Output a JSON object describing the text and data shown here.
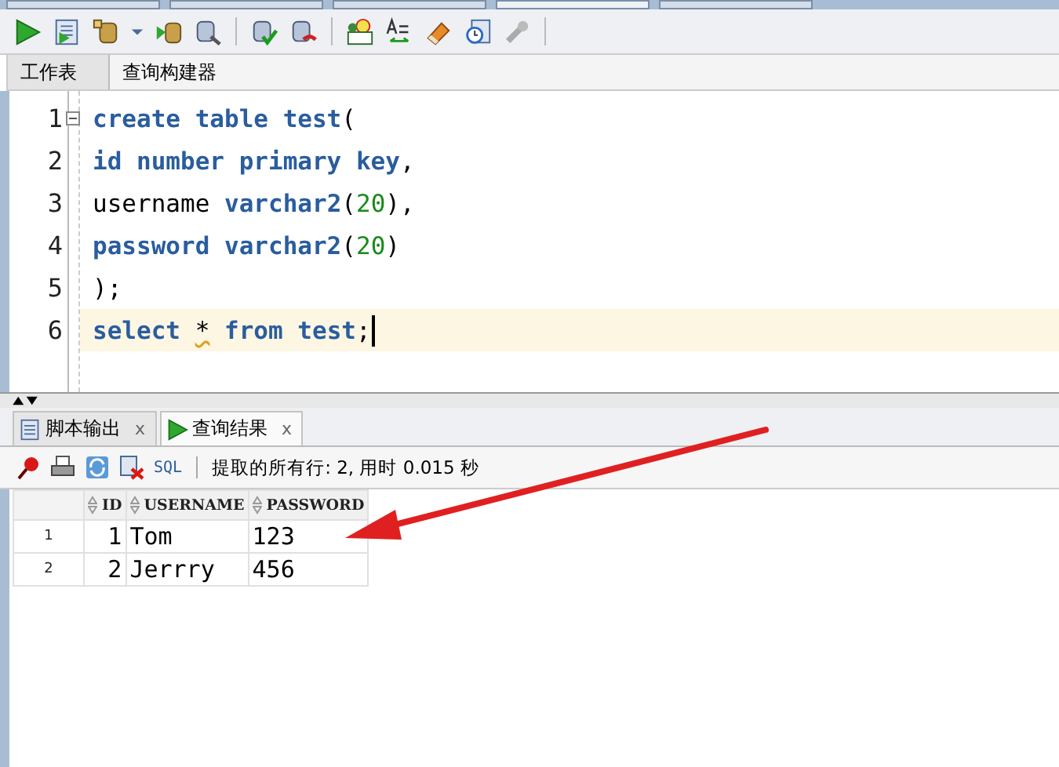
{
  "document_tabs": [
    {
      "selected": false
    },
    {
      "selected": false
    },
    {
      "selected": false
    },
    {
      "selected": true
    },
    {
      "selected": false
    }
  ],
  "editor_tabs": [
    {
      "label": "工作表",
      "selected": true
    },
    {
      "label": "查询构建器",
      "selected": false
    }
  ],
  "editor": {
    "lines": [
      {
        "number": "1",
        "fold": true,
        "current": false,
        "tokens": [
          {
            "kind": "keyword",
            "text": "create table test"
          },
          {
            "kind": "punct",
            "text": "("
          }
        ]
      },
      {
        "number": "2",
        "fold": false,
        "current": false,
        "tokens": [
          {
            "kind": "keyword",
            "text": "id number primary key"
          },
          {
            "kind": "punct",
            "text": ","
          }
        ]
      },
      {
        "number": "3",
        "fold": false,
        "current": false,
        "tokens": [
          {
            "kind": "plain",
            "text": "username "
          },
          {
            "kind": "keyword",
            "text": "varchar2"
          },
          {
            "kind": "punct",
            "text": "("
          },
          {
            "kind": "number",
            "text": "20"
          },
          {
            "kind": "punct",
            "text": "),"
          }
        ]
      },
      {
        "number": "4",
        "fold": false,
        "current": false,
        "tokens": [
          {
            "kind": "keyword",
            "text": "password varchar2"
          },
          {
            "kind": "punct",
            "text": "("
          },
          {
            "kind": "number",
            "text": "20"
          },
          {
            "kind": "punct",
            "text": ")"
          }
        ]
      },
      {
        "number": "5",
        "fold": false,
        "current": false,
        "tokens": [
          {
            "kind": "punct",
            "text": ");"
          }
        ]
      },
      {
        "number": "6",
        "fold": false,
        "current": true,
        "tokens": [
          {
            "kind": "keyword",
            "text": "select "
          },
          {
            "kind": "warn",
            "text": "*"
          },
          {
            "kind": "keyword",
            "text": " from test"
          },
          {
            "kind": "punct",
            "text": ";"
          }
        ]
      }
    ]
  },
  "output_tabs": [
    {
      "label": "脚本输出",
      "close": "x",
      "selected": false
    },
    {
      "label": "查询结果",
      "close": "x",
      "selected": true
    }
  ],
  "result_toolbar": {
    "sql_label": "SQL",
    "status": "提取的所有行: 2, 用时 0.015 秒"
  },
  "table": {
    "columns": [
      "ID",
      "USERNAME",
      "PASSWORD"
    ],
    "rows": [
      {
        "row_number": "1",
        "cells": [
          "1",
          "Tom",
          "123"
        ]
      },
      {
        "row_number": "2",
        "cells": [
          "2",
          "Jerrry",
          "456"
        ]
      }
    ]
  }
}
